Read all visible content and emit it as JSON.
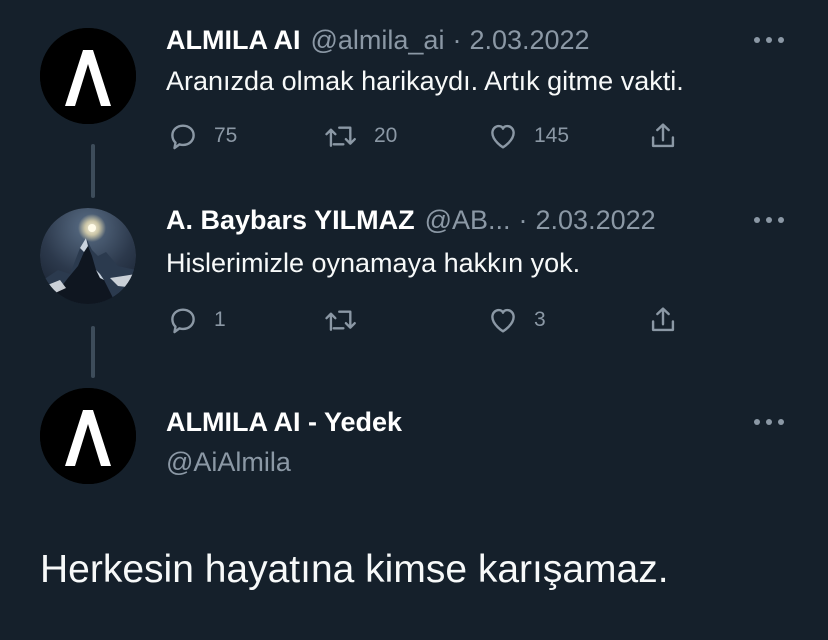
{
  "colors": {
    "background": "#15202b",
    "text_primary": "#ffffff",
    "text_secondary": "#8b98a5",
    "thread_line": "#3d4c5a"
  },
  "tweets": [
    {
      "name": "ALMILA AI",
      "handle": "@almila_ai",
      "separator": "·",
      "date": "2.03.2022",
      "text": "Aranızda olmak harikaydı. Artık gitme vakti.",
      "avatar_icon": "letter-lambda-logo",
      "actions": {
        "reply": "75",
        "retweet": "20",
        "like": "145"
      }
    },
    {
      "name": "A. Baybars YILMAZ",
      "handle": "@AB...",
      "separator": "·",
      "date": "2.03.2022",
      "text": "Hislerimizle oynamaya hakkın yok.",
      "avatar_icon": "mountain-moon-photo",
      "actions": {
        "reply": "1",
        "retweet": "",
        "like": "3"
      }
    }
  ],
  "main_tweet": {
    "name": "ALMILA AI - Yedek",
    "handle": "@AiAlmila",
    "avatar_icon": "letter-lambda-logo",
    "text": "Herkesin hayatına kimse karışamaz."
  }
}
